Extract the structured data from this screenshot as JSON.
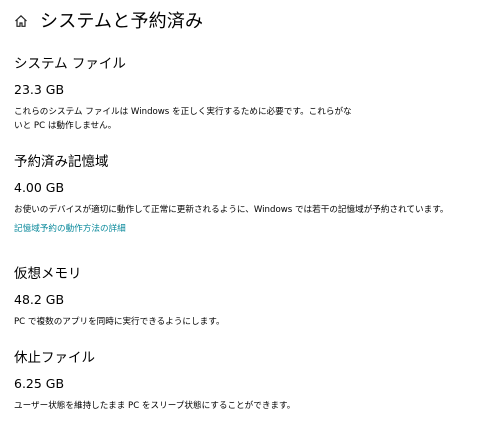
{
  "header": {
    "title": "システムと予約済み",
    "home_icon": "home-icon"
  },
  "sections": [
    {
      "title": "システム ファイル",
      "size": "23.3 GB",
      "description_lines": [
        "これらのシステム ファイルは Windows を正しく実行するために必要です。これらがな",
        "いと PC は動作しません。"
      ]
    },
    {
      "title": "予約済み記憶域",
      "size": "4.00 GB",
      "description_lines": [
        "お使いのデバイスが適切に動作して正常に更新されるように、Windows では若干の記憶域が予約されています。"
      ],
      "link": "記憶域予約の動作方法の詳細"
    },
    {
      "title": "仮想メモリ",
      "size": "48.2 GB",
      "description_lines": [
        "PC で複数のアプリを同時に実行できるようにします。"
      ]
    },
    {
      "title": "休止ファイル",
      "size": "6.25 GB",
      "description_lines": [
        "ユーザー状態を維持したまま PC をスリープ状態にすることができます。"
      ]
    }
  ],
  "colors": {
    "link": "#0b8a9c",
    "text": "#000000",
    "background": "#ffffff"
  }
}
